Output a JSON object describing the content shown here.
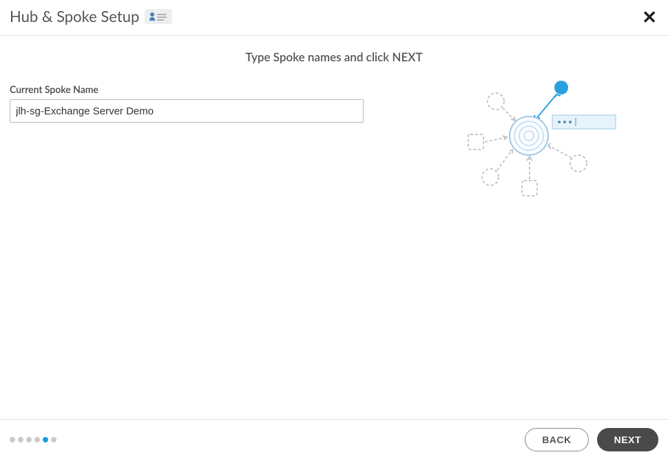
{
  "header": {
    "title": "Hub & Spoke Setup"
  },
  "instruction": "Type Spoke names and click NEXT",
  "form": {
    "spoke_name_label": "Current Spoke Name",
    "spoke_name_value": "jlh-sg-Exchange Server Demo"
  },
  "footer": {
    "back_label": "BACK",
    "next_label": "NEXT",
    "steps_total": 6,
    "steps_current_index": 4
  }
}
